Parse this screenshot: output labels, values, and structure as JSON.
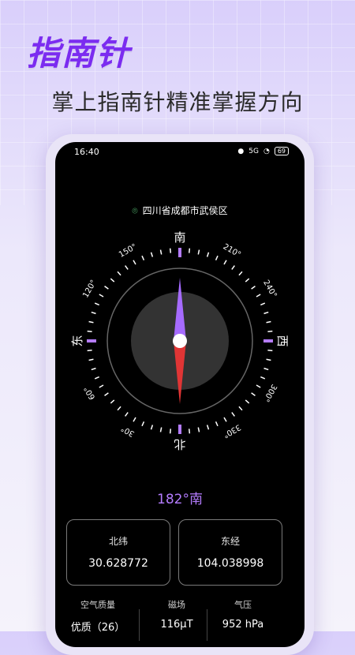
{
  "promo": {
    "title": "指南针",
    "subtitle": "掌上指南针精准掌握方向"
  },
  "status_bar": {
    "time": "16:40",
    "signal_label": "5G",
    "battery": "69"
  },
  "location": {
    "text": "四川省成都市武侯区"
  },
  "compass": {
    "heading_deg": 182,
    "cardinals": {
      "top": "南",
      "right": "西",
      "bottom": "北",
      "left": "东"
    },
    "degree_labels": [
      "150°",
      "210°",
      "240°",
      "300°",
      "330°",
      "30°",
      "60°",
      "120°"
    ],
    "accent": "#b47cff",
    "needle_north": "#e03535",
    "needle_south": "#a66bff"
  },
  "readout": {
    "heading": "182°南"
  },
  "cards": {
    "latitude": {
      "label": "北纬",
      "value": "30.628772"
    },
    "longitude": {
      "label": "东经",
      "value": "104.038998"
    }
  },
  "env": {
    "air": {
      "label": "空气质量",
      "value": "优质（26）"
    },
    "magnetic": {
      "label": "磁场",
      "value": "116μT"
    },
    "pressure": {
      "label": "气压",
      "value": "952 hPa"
    }
  }
}
